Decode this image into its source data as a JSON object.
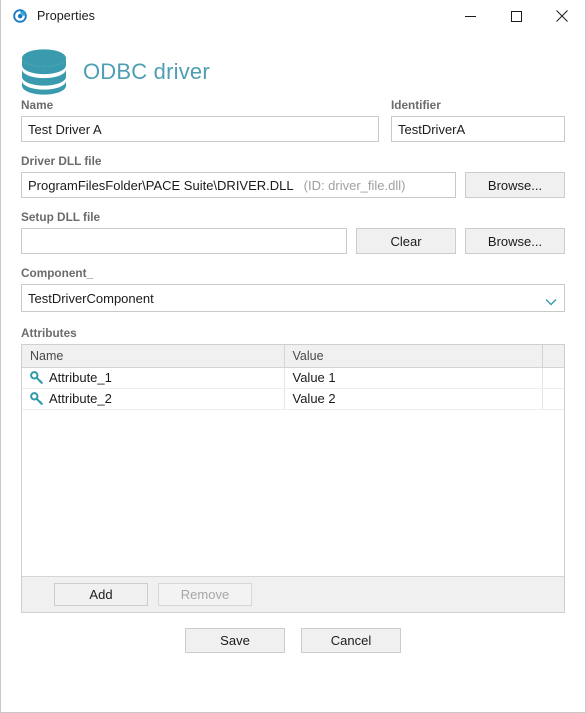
{
  "window": {
    "title": "Properties",
    "app_icon": "pace-suite-icon",
    "caption": {
      "minimize": "minimize-icon",
      "maximize": "maximize-icon",
      "close": "close-icon"
    }
  },
  "header": {
    "icon": "database-icon",
    "title": "ODBC driver"
  },
  "colors": {
    "accent_teal": "#3a9aae",
    "title_teal": "#4f9fb3",
    "key_icon": "#2e9aa8",
    "button_face": "#f0f0f0",
    "border": "#c9c9c9"
  },
  "form": {
    "name": {
      "label": "Name",
      "value": "Test Driver A",
      "placeholder": ""
    },
    "identifier": {
      "label": "Identifier",
      "value": "TestDriverA",
      "placeholder": ""
    },
    "driver_dll": {
      "label": "Driver DLL file",
      "value": "ProgramFilesFolder\\PACE Suite\\DRIVER.DLL",
      "hint": "(ID: driver_file.dll)",
      "placeholder": "",
      "browse_label": "Browse..."
    },
    "setup_dll": {
      "label": "Setup DLL file",
      "value": "",
      "placeholder": "",
      "clear_label": "Clear",
      "browse_label": "Browse..."
    },
    "component": {
      "label": "Component_",
      "value": "TestDriverComponent",
      "chevron": "chevron-down-icon"
    }
  },
  "attributes": {
    "label": "Attributes",
    "columns": [
      "Name",
      "Value",
      ""
    ],
    "rows": [
      {
        "icon": "key-icon",
        "name": "Attribute_1",
        "value": "Value 1"
      },
      {
        "icon": "key-icon",
        "name": "Attribute_2",
        "value": "Value 2"
      }
    ],
    "add_label": "Add",
    "remove_label": "Remove",
    "remove_disabled": true
  },
  "footer": {
    "save_label": "Save",
    "cancel_label": "Cancel"
  }
}
